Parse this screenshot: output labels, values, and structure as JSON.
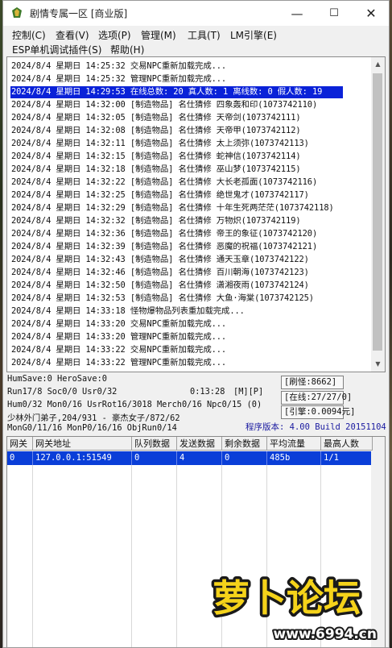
{
  "window": {
    "title": "剧情专属一区 [商业版]",
    "controls": {
      "minimize": "—",
      "maximize": "☐",
      "close": "✕"
    }
  },
  "menu": {
    "row1": [
      "控制(C)",
      "查看(V)",
      "选项(P)",
      "管理(M)",
      "工具(T)",
      "LM引擎(E)"
    ],
    "row2": [
      "ESP单机调试插件(S)",
      "帮助(H)"
    ]
  },
  "log": {
    "lines": [
      "2024/8/4 星期日 14:25:32 交易NPC重新加载完成...",
      "2024/8/4 星期日 14:25:32 管理NPC重新加载完成...",
      "2024/8/4 星期日 14:29:53 在线总数: 20 真人数: 1 离线数: 0 假人数: 19",
      "2024/8/4 星期日 14:32:00 [制造物品] 名仕猜修 四象轰和印(1073742110)",
      "2024/8/4 星期日 14:32:05 [制造物品] 名仕猜修 天帝剑(1073742111)",
      "2024/8/4 星期日 14:32:08 [制造物品] 名仕猜修 天帝甲(1073742112)",
      "2024/8/4 星期日 14:32:11 [制造物品] 名仕猜修 太上须弥(1073742113)",
      "2024/8/4 星期日 14:32:15 [制造物品] 名仕猜修 蛇神信(1073742114)",
      "2024/8/4 星期日 14:32:18 [制造物品] 名仕猜修 巫山梦(1073742115)",
      "2024/8/4 星期日 14:32:22 [制造物品] 名仕猜修 大长老孤面(1073742116)",
      "2024/8/4 星期日 14:32:25 [制造物品] 名仕猜修 绝世鬼才(1073742117)",
      "2024/8/4 星期日 14:32:29 [制造物品] 名仕猜修 十年生死两茫茫(1073742118)",
      "2024/8/4 星期日 14:32:32 [制造物品] 名仕猜修 万物炽(1073742119)",
      "2024/8/4 星期日 14:32:36 [制造物品] 名仕猜修 帝王的象征(1073742120)",
      "2024/8/4 星期日 14:32:39 [制造物品] 名仕猜修 恶魔的祝福(1073742121)",
      "2024/8/4 星期日 14:32:43 [制造物品] 名仕猜修 通天玉章(1073742122)",
      "2024/8/4 星期日 14:32:46 [制造物品] 名仕猜修 百川朝海(1073742123)",
      "2024/8/4 星期日 14:32:50 [制造物品] 名仕猜修 潇湘夜雨(1073742124)",
      "2024/8/4 星期日 14:32:53 [制造物品] 名仕猜修 大鱼·海棠(1073742125)",
      "2024/8/4 星期日 14:33:18 怪物爆物品列表重加载完成...",
      "2024/8/4 星期日 14:33:20 交易NPC重新加载完成...",
      "2024/8/4 星期日 14:33:20 管理NPC重新加载完成...",
      "2024/8/4 星期日 14:33:22 交易NPC重新加载完成...",
      "2024/8/4 星期日 14:33:22 管理NPC重新加载完成..."
    ],
    "selected_index": 2,
    "selected_bg": "#0a22d8"
  },
  "status": {
    "hum_save": "HumSave:0 HeroSave:0",
    "run": "Run17/8 Soc0/0 Usr0/32",
    "uptime": "0:13:28",
    "flags": "[M][P]",
    "hum": "Hum0/32 Mon0/16 UsrRot16/3018 Merch0/16 Npc0/15 (0)",
    "player": "少林外门弟子,204/931 - 豪杰女子/872/62",
    "mon": "MonG0/11/16 MonP0/16/16 ObjRun0/14",
    "refresh": "[刷怪:8662]",
    "online": "[在线:27/27/0]",
    "credit": "[引擎:0.0094元]",
    "version": "程序版本: 4.00 Build 20151104"
  },
  "gateway_table": {
    "headers": [
      "网关",
      "网关地址",
      "队列数据",
      "发送数据",
      "剩余数据",
      "平均流量",
      "最高人数"
    ],
    "rows": [
      [
        "0",
        "127.0.0.1:51549",
        "0",
        "4",
        "0",
        "485b",
        "1/1"
      ]
    ],
    "row_bg": "#0a3ed8"
  },
  "watermark": {
    "text": "萝卜论坛",
    "url": "www.6994.cn",
    "fill": "#f5d31a",
    "stroke": "#1a1a1a"
  }
}
